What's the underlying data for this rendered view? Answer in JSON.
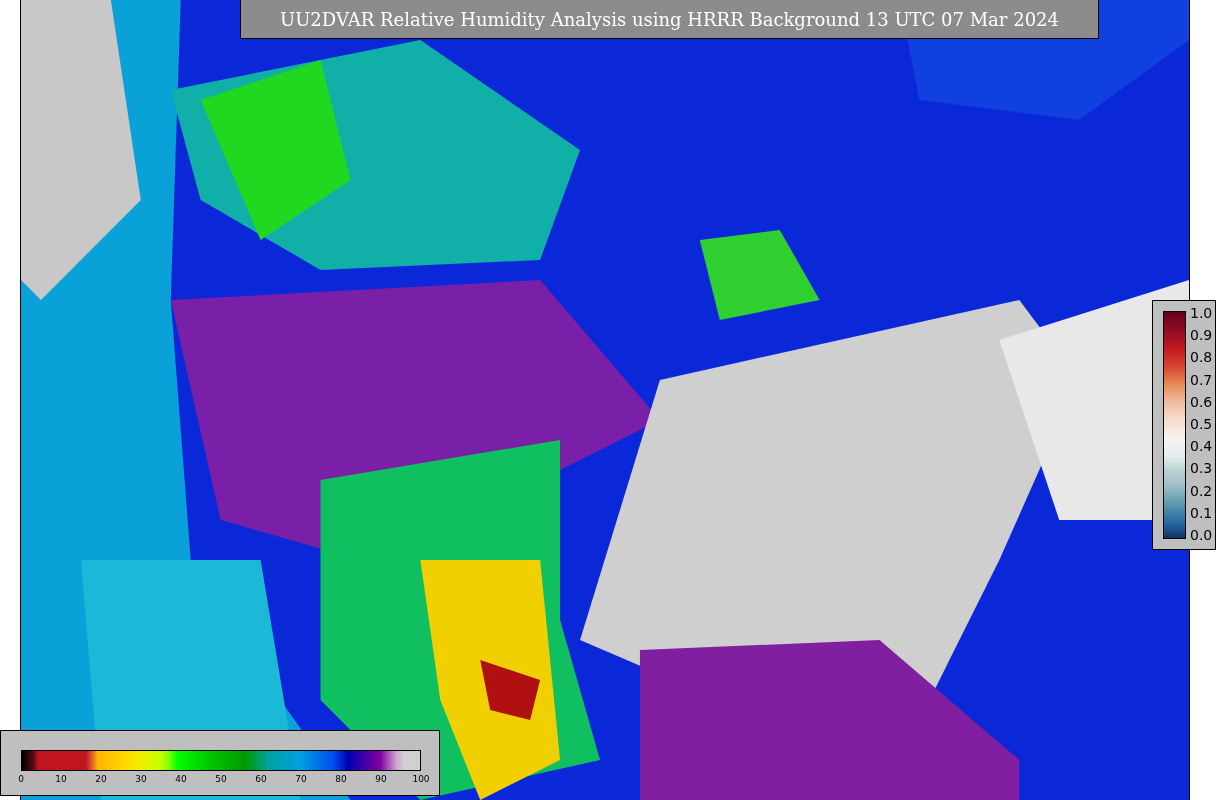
{
  "title": "UU2DVAR Relative Humidity Analysis using HRRR Background 13 UTC 07 Mar 2024",
  "observation_colorbar": {
    "ticks": [
      "1.0",
      "0.9",
      "0.8",
      "0.7",
      "0.6",
      "0.5",
      "0.4",
      "0.3",
      "0.2",
      "0.1",
      "0.0"
    ]
  },
  "humidity_colorbar": {
    "ticks": [
      "0",
      "10",
      "20",
      "30",
      "40",
      "50",
      "60",
      "70",
      "80",
      "90",
      "100"
    ]
  }
}
